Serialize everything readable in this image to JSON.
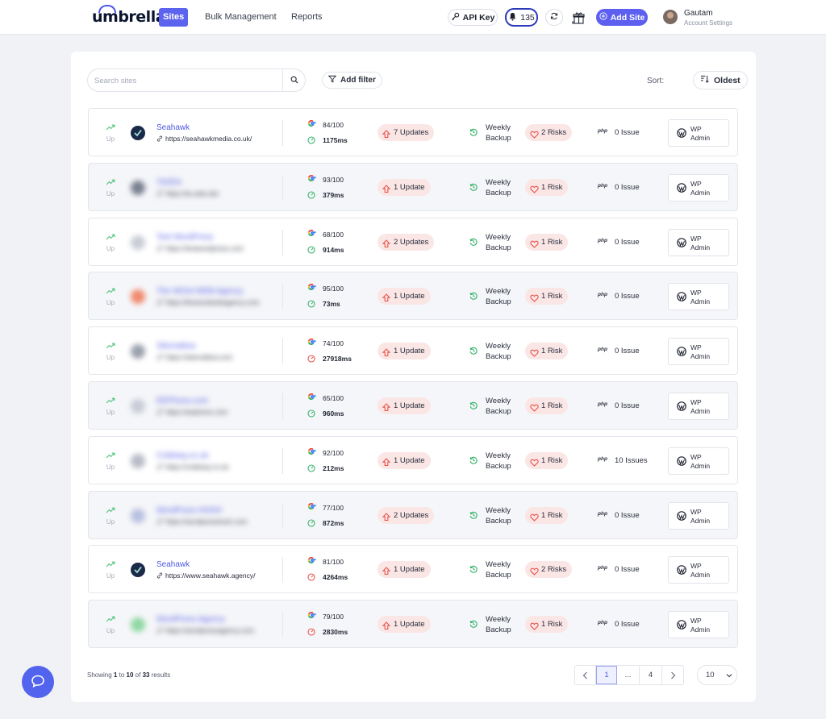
{
  "header": {
    "logo": "umbrella",
    "nav": [
      {
        "label": "Sites",
        "active": true
      },
      {
        "label": "Bulk Management",
        "active": false
      },
      {
        "label": "Reports",
        "active": false
      }
    ],
    "api_key_label": "API Key",
    "notifications_count": "135",
    "add_site_label": "Add Site",
    "user_name": "Gautam",
    "user_sub": "Account Settings",
    "accent_color": "#5c63ef"
  },
  "toolbar": {
    "search_placeholder": "Search sites",
    "filter_label": "Add filter",
    "sort_label": "Sort:",
    "sort_value": "Oldest"
  },
  "sites": [
    {
      "status": "Up",
      "name": "Seahawk",
      "url": "https://seahawkmedia.co.uk/",
      "blurred": false,
      "icon_color": "#1c2a4a",
      "score": "84/100",
      "load": "1175ms",
      "load_slow": false,
      "updates": "7 Updates",
      "backup": [
        "Weekly",
        "Backup"
      ],
      "risks": "2 Risks",
      "issues": "0 Issue",
      "wp": [
        "WP",
        "Admin"
      ]
    },
    {
      "status": "Up",
      "name": "TA2EA",
      "url": "https://ta.web.site",
      "blurred": true,
      "icon_color": "#7a8090",
      "score": "93/100",
      "load": "379ms",
      "load_slow": false,
      "updates": "1 Update",
      "backup": [
        "Weekly",
        "Backup"
      ],
      "risks": "1 Risk",
      "issues": "0 Issue",
      "wp": [
        "WP",
        "Admin"
      ]
    },
    {
      "status": "Up",
      "name": "Test WordPress",
      "url": "https://testwordpress.com",
      "blurred": true,
      "icon_color": "#c8ccd6",
      "score": "68/100",
      "load": "914ms",
      "load_slow": false,
      "updates": "2 Updates",
      "backup": [
        "Weekly",
        "Backup"
      ],
      "risks": "1 Risk",
      "issues": "0 Issue",
      "wp": [
        "WP",
        "Admin"
      ]
    },
    {
      "status": "Up",
      "name": "The WOrd WEB Agency",
      "url": "https://thewordwebagency.com",
      "blurred": true,
      "icon_color": "#f08a6e",
      "score": "95/100",
      "load": "73ms",
      "load_slow": false,
      "updates": "1 Update",
      "backup": [
        "Weekly",
        "Backup"
      ],
      "risks": "1 Risk",
      "issues": "0 Issue",
      "wp": [
        "WP",
        "Admin"
      ]
    },
    {
      "status": "Up",
      "name": "Sitemallow",
      "url": "https://sitemallow.com",
      "blurred": true,
      "icon_color": "#9aa0ac",
      "score": "74/100",
      "load": "27918ms",
      "load_slow": true,
      "updates": "1 Update",
      "backup": [
        "Weekly",
        "Backup"
      ],
      "risks": "1 Risk",
      "issues": "0 Issue",
      "wp": [
        "WP",
        "Admin"
      ]
    },
    {
      "status": "Up",
      "name": "EEPhone.com",
      "url": "https://eephone.com",
      "blurred": true,
      "icon_color": "#c8ccd6",
      "score": "65/100",
      "load": "960ms",
      "load_slow": false,
      "updates": "1 Update",
      "backup": [
        "Weekly",
        "Backup"
      ],
      "risks": "1 Risk",
      "issues": "0 Issue",
      "wp": [
        "WP",
        "Admin"
      ]
    },
    {
      "status": "Up",
      "name": "Coldway.co.uk",
      "url": "https://coldway.co.uk",
      "blurred": true,
      "icon_color": "#b8bcc6",
      "score": "92/100",
      "load": "212ms",
      "load_slow": false,
      "updates": "1 Update",
      "backup": [
        "Weekly",
        "Backup"
      ],
      "risks": "1 Risk",
      "issues": "10 Issues",
      "wp": [
        "WP",
        "Admin"
      ]
    },
    {
      "status": "Up",
      "name": "WordPress HOSH",
      "url": "https://wordpresshosh.com",
      "blurred": true,
      "icon_color": "#b8c0e0",
      "score": "77/100",
      "load": "872ms",
      "load_slow": false,
      "updates": "2 Updates",
      "backup": [
        "Weekly",
        "Backup"
      ],
      "risks": "1 Risk",
      "issues": "0 Issue",
      "wp": [
        "WP",
        "Admin"
      ]
    },
    {
      "status": "Up",
      "name": "Seahawk",
      "url": "https://www.seahawk.agency/",
      "blurred": false,
      "icon_color": "#1c2a4a",
      "score": "81/100",
      "load": "4264ms",
      "load_slow": true,
      "updates": "1 Update",
      "backup": [
        "Weekly",
        "Backup"
      ],
      "risks": "2 Risks",
      "issues": "0 Issue",
      "wp": [
        "WP",
        "Admin"
      ]
    },
    {
      "status": "Up",
      "name": "WordPress Agency",
      "url": "https://wordpressagency.com",
      "blurred": true,
      "icon_color": "#8fd8a2",
      "score": "79/100",
      "load": "2830ms",
      "load_slow": true,
      "updates": "1 Update",
      "backup": [
        "Weekly",
        "Backup"
      ],
      "risks": "1 Risk",
      "issues": "0 Issue",
      "wp": [
        "WP",
        "Admin"
      ]
    }
  ],
  "footer": {
    "showing_prefix": "Showing",
    "from": "1",
    "to_word": "to",
    "to": "10",
    "of_word": "of",
    "total": "33",
    "results_word": "results",
    "pages": [
      "1",
      "...",
      "4"
    ],
    "per_page": "10"
  },
  "colors": {
    "status_up": "#4cc37a",
    "speed_fast": "#34b26a",
    "speed_slow": "#e8544a",
    "badge_bg": "#fbe6e6",
    "link": "#4d58e4"
  }
}
